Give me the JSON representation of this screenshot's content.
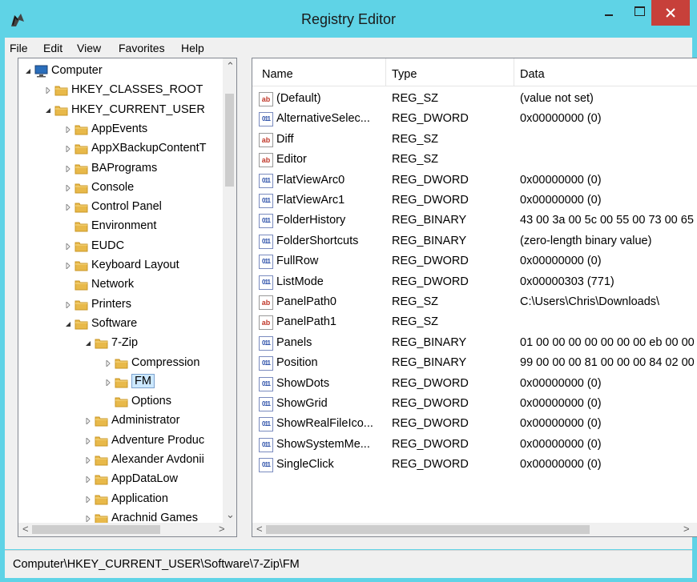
{
  "window": {
    "title": "Registry Editor"
  },
  "menu": [
    "File",
    "Edit",
    "View",
    "Favorites",
    "Help"
  ],
  "tree": [
    {
      "label": "Computer",
      "level": 0,
      "exp": "open",
      "icon": "computer-icon"
    },
    {
      "label": "HKEY_CLASSES_ROOT",
      "level": 1,
      "exp": "closed",
      "icon": "folder-icon"
    },
    {
      "label": "HKEY_CURRENT_USER",
      "level": 1,
      "exp": "open",
      "icon": "folder-icon"
    },
    {
      "label": "AppEvents",
      "level": 2,
      "exp": "closed",
      "icon": "folder-icon"
    },
    {
      "label": "AppXBackupContentT",
      "level": 2,
      "exp": "closed",
      "icon": "folder-icon"
    },
    {
      "label": "BAPrograms",
      "level": 2,
      "exp": "closed",
      "icon": "folder-icon"
    },
    {
      "label": "Console",
      "level": 2,
      "exp": "closed",
      "icon": "folder-icon"
    },
    {
      "label": "Control Panel",
      "level": 2,
      "exp": "closed",
      "icon": "folder-icon"
    },
    {
      "label": "Environment",
      "level": 2,
      "exp": "none",
      "icon": "folder-icon"
    },
    {
      "label": "EUDC",
      "level": 2,
      "exp": "closed",
      "icon": "folder-icon"
    },
    {
      "label": "Keyboard Layout",
      "level": 2,
      "exp": "closed",
      "icon": "folder-icon"
    },
    {
      "label": "Network",
      "level": 2,
      "exp": "none",
      "icon": "folder-icon"
    },
    {
      "label": "Printers",
      "level": 2,
      "exp": "closed",
      "icon": "folder-icon"
    },
    {
      "label": "Software",
      "level": 2,
      "exp": "open",
      "icon": "folder-icon"
    },
    {
      "label": "7-Zip",
      "level": 3,
      "exp": "open",
      "icon": "folder-icon"
    },
    {
      "label": "Compression",
      "level": 4,
      "exp": "closed",
      "icon": "folder-icon"
    },
    {
      "label": "FM",
      "level": 4,
      "exp": "closed",
      "icon": "folder-icon",
      "selected": true
    },
    {
      "label": "Options",
      "level": 4,
      "exp": "none",
      "icon": "folder-icon"
    },
    {
      "label": "Administrator",
      "level": 3,
      "exp": "closed",
      "icon": "folder-icon"
    },
    {
      "label": "Adventure Produc",
      "level": 3,
      "exp": "closed",
      "icon": "folder-icon"
    },
    {
      "label": "Alexander Avdonii",
      "level": 3,
      "exp": "closed",
      "icon": "folder-icon"
    },
    {
      "label": "AppDataLow",
      "level": 3,
      "exp": "closed",
      "icon": "folder-icon"
    },
    {
      "label": "Application",
      "level": 3,
      "exp": "closed",
      "icon": "folder-icon"
    },
    {
      "label": "Arachnid Games",
      "level": 3,
      "exp": "closed",
      "icon": "folder-icon"
    }
  ],
  "list": {
    "headers": {
      "name": "Name",
      "type": "Type",
      "data": "Data"
    },
    "rows": [
      {
        "name": "(Default)",
        "type": "REG_SZ",
        "data": "(value not set)",
        "icon": "string-value-icon"
      },
      {
        "name": "AlternativeSelec...",
        "type": "REG_DWORD",
        "data": "0x00000000 (0)",
        "icon": "binary-value-icon"
      },
      {
        "name": "Diff",
        "type": "REG_SZ",
        "data": "",
        "icon": "string-value-icon"
      },
      {
        "name": "Editor",
        "type": "REG_SZ",
        "data": "",
        "icon": "string-value-icon"
      },
      {
        "name": "FlatViewArc0",
        "type": "REG_DWORD",
        "data": "0x00000000 (0)",
        "icon": "binary-value-icon"
      },
      {
        "name": "FlatViewArc1",
        "type": "REG_DWORD",
        "data": "0x00000000 (0)",
        "icon": "binary-value-icon"
      },
      {
        "name": "FolderHistory",
        "type": "REG_BINARY",
        "data": "43 00 3a 00 5c 00 55 00 73 00 65",
        "icon": "binary-value-icon"
      },
      {
        "name": "FolderShortcuts",
        "type": "REG_BINARY",
        "data": "(zero-length binary value)",
        "icon": "binary-value-icon"
      },
      {
        "name": "FullRow",
        "type": "REG_DWORD",
        "data": "0x00000000 (0)",
        "icon": "binary-value-icon"
      },
      {
        "name": "ListMode",
        "type": "REG_DWORD",
        "data": "0x00000303 (771)",
        "icon": "binary-value-icon"
      },
      {
        "name": "PanelPath0",
        "type": "REG_SZ",
        "data": "C:\\Users\\Chris\\Downloads\\",
        "icon": "string-value-icon"
      },
      {
        "name": "PanelPath1",
        "type": "REG_SZ",
        "data": "",
        "icon": "string-value-icon"
      },
      {
        "name": "Panels",
        "type": "REG_BINARY",
        "data": "01 00 00 00 00 00 00 00 eb 00 00",
        "icon": "binary-value-icon"
      },
      {
        "name": "Position",
        "type": "REG_BINARY",
        "data": "99 00 00 00 81 00 00 00 84 02 00",
        "icon": "binary-value-icon"
      },
      {
        "name": "ShowDots",
        "type": "REG_DWORD",
        "data": "0x00000000 (0)",
        "icon": "binary-value-icon"
      },
      {
        "name": "ShowGrid",
        "type": "REG_DWORD",
        "data": "0x00000000 (0)",
        "icon": "binary-value-icon"
      },
      {
        "name": "ShowRealFileIco...",
        "type": "REG_DWORD",
        "data": "0x00000000 (0)",
        "icon": "binary-value-icon"
      },
      {
        "name": "ShowSystemMe...",
        "type": "REG_DWORD",
        "data": "0x00000000 (0)",
        "icon": "binary-value-icon"
      },
      {
        "name": "SingleClick",
        "type": "REG_DWORD",
        "data": "0x00000000 (0)",
        "icon": "binary-value-icon"
      }
    ]
  },
  "status": {
    "path": "Computer\\HKEY_CURRENT_USER\\Software\\7-Zip\\FM"
  },
  "colors": {
    "titlebar": "#5fd3e6",
    "close": "#c7403a",
    "selection": "#cce8ff",
    "folder": "#e8b94a"
  }
}
